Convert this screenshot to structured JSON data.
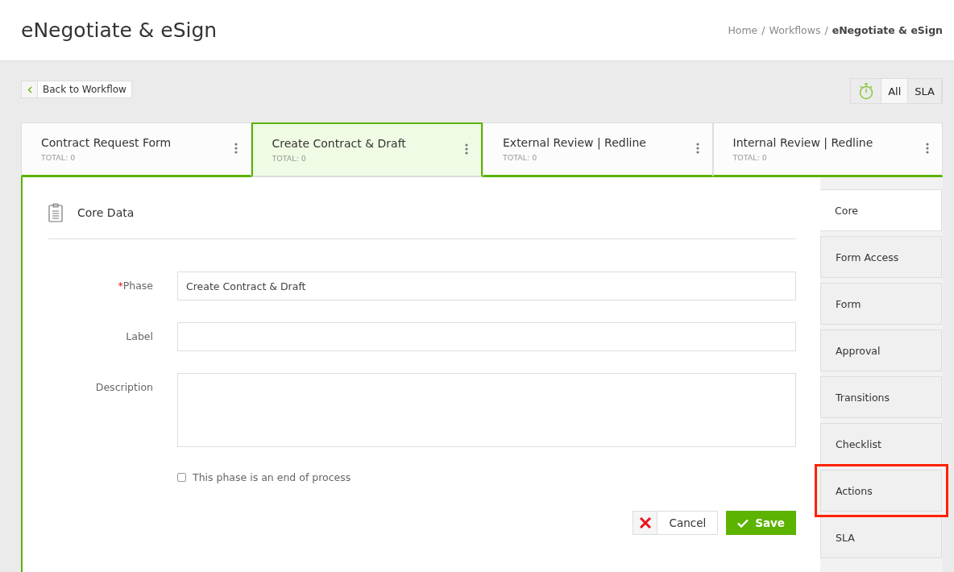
{
  "header": {
    "title": "eNegotiate & eSign",
    "breadcrumbs": [
      {
        "label": "Home",
        "separator": "/",
        "current": false
      },
      {
        "label": "Workflows",
        "separator": "/",
        "current": false
      },
      {
        "label": "eNegotiate & eSign",
        "current": true
      }
    ]
  },
  "back_button": {
    "label": "Back to Workflow"
  },
  "filter": {
    "options": [
      {
        "label": "All",
        "selected": true
      },
      {
        "label": "SLA",
        "selected": false
      }
    ]
  },
  "phases": [
    {
      "name": "Contract Request Form",
      "total": "TOTAL: 0",
      "selected": false
    },
    {
      "name": "Create Contract & Draft",
      "total": "TOTAL: 0",
      "selected": true
    },
    {
      "name": "External Review | Redline",
      "total": "TOTAL: 0",
      "selected": false
    },
    {
      "name": "Internal Review | Redline",
      "total": "TOTAL: 0",
      "selected": false
    }
  ],
  "section": {
    "title": "Core Data"
  },
  "fields": [
    {
      "kind": "input",
      "label": "Phase",
      "required_mark": "*",
      "value": "Create Contract & Draft"
    },
    {
      "kind": "input",
      "label": "Label"
    },
    {
      "kind": "textarea",
      "label": "Description"
    }
  ],
  "end_checkbox": {
    "label": "This phase is an end of process",
    "checked": false
  },
  "buttons": [
    {
      "kind": "cancel",
      "label": "Cancel"
    },
    {
      "kind": "save",
      "label": "Save"
    }
  ],
  "side_tabs": [
    {
      "label": "Core",
      "selected": true,
      "highlighted": false
    },
    {
      "label": "Form Access",
      "selected": false,
      "highlighted": false
    },
    {
      "label": "Form",
      "selected": false,
      "highlighted": false
    },
    {
      "label": "Approval",
      "selected": false,
      "highlighted": false
    },
    {
      "label": "Transitions",
      "selected": false,
      "highlighted": false
    },
    {
      "label": "Checklist",
      "selected": false,
      "highlighted": false
    },
    {
      "label": "Actions",
      "selected": false,
      "highlighted": true
    },
    {
      "label": "SLA",
      "selected": false,
      "highlighted": false
    }
  ]
}
